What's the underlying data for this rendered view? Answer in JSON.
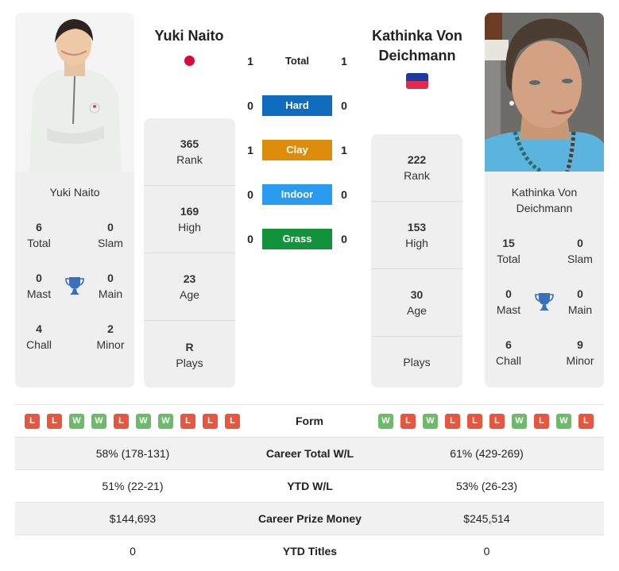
{
  "player1": {
    "name": "Yuki Naito",
    "card_name": "Yuki Naito",
    "flag": "japan-flag",
    "titles": {
      "total": {
        "value": "6",
        "label": "Total"
      },
      "slam": {
        "value": "0",
        "label": "Slam"
      },
      "mast": {
        "value": "0",
        "label": "Mast"
      },
      "main": {
        "value": "0",
        "label": "Main"
      },
      "chall": {
        "value": "4",
        "label": "Chall"
      },
      "minor": {
        "value": "2",
        "label": "Minor"
      }
    },
    "info": [
      {
        "value": "365",
        "label": "Rank"
      },
      {
        "value": "169",
        "label": "High"
      },
      {
        "value": "23",
        "label": "Age"
      },
      {
        "value": "R",
        "label": "Plays"
      }
    ],
    "form": [
      "L",
      "L",
      "W",
      "W",
      "L",
      "W",
      "W",
      "L",
      "L",
      "L"
    ]
  },
  "player2": {
    "name": "Kathinka Von Deichmann",
    "name_line1": "Kathinka Von",
    "name_line2": "Deichmann",
    "card_name_line1": "Kathinka Von",
    "card_name_line2": "Deichmann",
    "flag": "liechtenstein-flag",
    "titles": {
      "total": {
        "value": "15",
        "label": "Total"
      },
      "slam": {
        "value": "0",
        "label": "Slam"
      },
      "mast": {
        "value": "0",
        "label": "Mast"
      },
      "main": {
        "value": "0",
        "label": "Main"
      },
      "chall": {
        "value": "6",
        "label": "Chall"
      },
      "minor": {
        "value": "9",
        "label": "Minor"
      }
    },
    "info": [
      {
        "value": "222",
        "label": "Rank"
      },
      {
        "value": "153",
        "label": "High"
      },
      {
        "value": "30",
        "label": "Age"
      },
      {
        "value": "",
        "label": "Plays"
      }
    ],
    "form": [
      "W",
      "L",
      "W",
      "L",
      "L",
      "L",
      "W",
      "L",
      "W",
      "L"
    ]
  },
  "h2h": [
    {
      "label": "Total",
      "p1": "1",
      "p2": "1",
      "color": null
    },
    {
      "label": "Hard",
      "p1": "0",
      "p2": "0",
      "color": "#0e6bbd"
    },
    {
      "label": "Clay",
      "p1": "1",
      "p2": "1",
      "color": "#de8d0a"
    },
    {
      "label": "Indoor",
      "p1": "0",
      "p2": "0",
      "color": "#2b9bf0"
    },
    {
      "label": "Grass",
      "p1": "0",
      "p2": "0",
      "color": "#12923a"
    }
  ],
  "form_label": "Form",
  "stats": [
    {
      "label": "Career Total W/L",
      "p1": "58% (178-131)",
      "p2": "61% (429-269)"
    },
    {
      "label": "YTD W/L",
      "p1": "51% (22-21)",
      "p2": "53% (26-23)"
    },
    {
      "label": "Career Prize Money",
      "p1": "$144,693",
      "p2": "$245,514"
    },
    {
      "label": "YTD Titles",
      "p1": "0",
      "p2": "0"
    }
  ],
  "colors": {
    "win": "#6dba6a",
    "loss": "#e9563f",
    "trophy": "#3a6fbf",
    "card_bg": "#efefef"
  }
}
